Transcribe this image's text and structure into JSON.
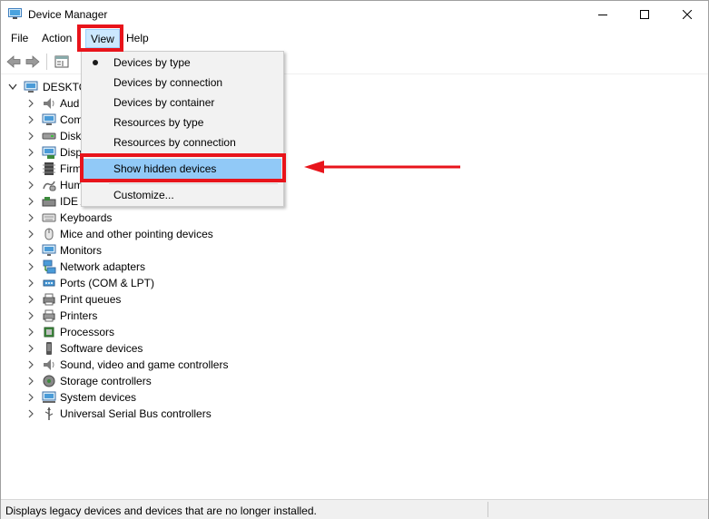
{
  "window": {
    "title": "Device Manager",
    "icon": "device-manager-icon"
  },
  "menubar": {
    "file": "File",
    "action": "Action",
    "view": "View",
    "help": "Help"
  },
  "toolbar": {
    "icons": [
      "back-arrow-icon",
      "forward-arrow-icon",
      "properties-icon"
    ]
  },
  "tree": {
    "root": "DESKTO",
    "items": [
      {
        "label": "Aud",
        "icon": "speaker-icon"
      },
      {
        "label": "Com",
        "icon": "computer-icon"
      },
      {
        "label": "Disk",
        "icon": "disk-drive-icon"
      },
      {
        "label": "Disp",
        "icon": "display-adapter-icon"
      },
      {
        "label": "Firm",
        "icon": "firmware-chip-icon"
      },
      {
        "label": "Hum",
        "icon": "human-interface-icon"
      },
      {
        "label": "IDE A",
        "icon": "ide-controller-icon"
      },
      {
        "label": "Keyboards",
        "icon": "keyboard-icon"
      },
      {
        "label": "Mice and other pointing devices",
        "icon": "mouse-icon"
      },
      {
        "label": "Monitors",
        "icon": "monitor-icon"
      },
      {
        "label": "Network adapters",
        "icon": "network-adapter-icon"
      },
      {
        "label": "Ports (COM & LPT)",
        "icon": "port-icon"
      },
      {
        "label": "Print queues",
        "icon": "print-queue-icon"
      },
      {
        "label": "Printers",
        "icon": "printer-icon"
      },
      {
        "label": "Processors",
        "icon": "processor-icon"
      },
      {
        "label": "Software devices",
        "icon": "software-device-icon"
      },
      {
        "label": "Sound, video and game controllers",
        "icon": "sound-icon"
      },
      {
        "label": "Storage controllers",
        "icon": "storage-controller-icon"
      },
      {
        "label": "System devices",
        "icon": "system-device-icon"
      },
      {
        "label": "Universal Serial Bus controllers",
        "icon": "usb-icon"
      }
    ]
  },
  "view_menu": {
    "items": [
      {
        "label": "Devices by type",
        "selected": true
      },
      {
        "label": "Devices by connection",
        "selected": false
      },
      {
        "label": "Devices by container",
        "selected": false
      },
      {
        "label": "Resources by type",
        "selected": false
      },
      {
        "label": "Resources by connection",
        "selected": false
      },
      {
        "label": "Show hidden devices",
        "selected": false,
        "hovered": true
      },
      {
        "label": "Customize...",
        "selected": false
      }
    ]
  },
  "annotation": {
    "highlight_color": "#e8141b"
  },
  "statusbar": {
    "text": "Displays legacy devices and devices that are no longer installed."
  }
}
